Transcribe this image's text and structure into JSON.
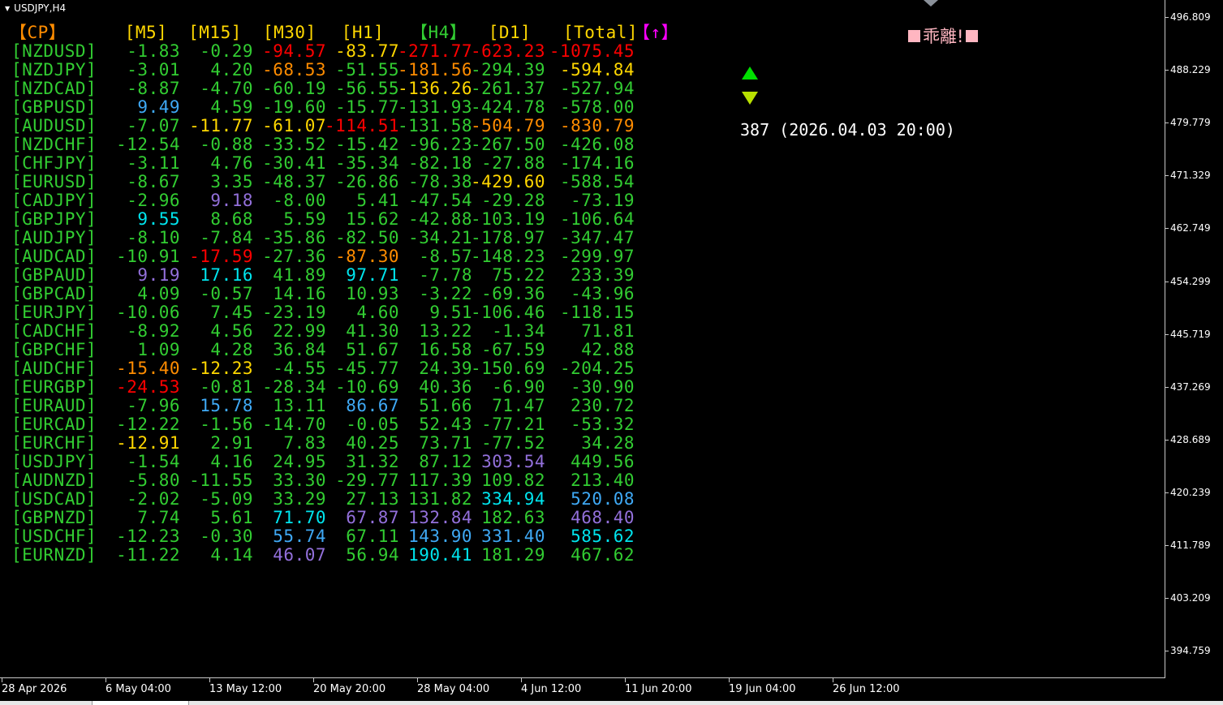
{
  "chart": {
    "title": "USDJPY,H4",
    "alert_text": "乖離!",
    "status_text": "387 (2026.04.03 20:00)"
  },
  "table": {
    "headers": [
      {
        "label": "【CP】",
        "color": "#ff8c00"
      },
      {
        "label": "[M5]",
        "color": "#ffd700"
      },
      {
        "label": "[M15]",
        "color": "#ffd700"
      },
      {
        "label": "[M30]",
        "color": "#ffd700"
      },
      {
        "label": "[H1]",
        "color": "#ffd700"
      },
      {
        "label": "【H4】",
        "color": "#32cd32"
      },
      {
        "label": "[D1]",
        "color": "#ffd700"
      },
      {
        "label": "[Total]",
        "color": "#ffd700"
      },
      {
        "label": "【↑】",
        "color": "#ff00ff"
      }
    ],
    "rows": [
      {
        "pair": "[NZDUSD]",
        "cells": [
          {
            "v": "-1.83",
            "c": "#32cd32"
          },
          {
            "v": "-0.29",
            "c": "#32cd32"
          },
          {
            "v": "-94.57",
            "c": "#ff0000"
          },
          {
            "v": "-83.77",
            "c": "#ffd700"
          },
          {
            "v": "-271.77",
            "c": "#ff0000"
          },
          {
            "v": "-623.23",
            "c": "#ff0000"
          },
          {
            "v": "-1075.45",
            "c": "#ff0000"
          }
        ]
      },
      {
        "pair": "[NZDJPY]",
        "cells": [
          {
            "v": "-3.01",
            "c": "#32cd32"
          },
          {
            "v": "4.20",
            "c": "#32cd32"
          },
          {
            "v": "-68.53",
            "c": "#ff8c00"
          },
          {
            "v": "-51.55",
            "c": "#32cd32"
          },
          {
            "v": "-181.56",
            "c": "#ff8c00"
          },
          {
            "v": "-294.39",
            "c": "#32cd32"
          },
          {
            "v": "-594.84",
            "c": "#ffd700"
          }
        ]
      },
      {
        "pair": "[NZDCAD]",
        "cells": [
          {
            "v": "-8.87",
            "c": "#32cd32"
          },
          {
            "v": "-4.70",
            "c": "#32cd32"
          },
          {
            "v": "-60.19",
            "c": "#32cd32"
          },
          {
            "v": "-56.55",
            "c": "#32cd32"
          },
          {
            "v": "-136.26",
            "c": "#ffd700"
          },
          {
            "v": "-261.37",
            "c": "#32cd32"
          },
          {
            "v": "-527.94",
            "c": "#32cd32"
          }
        ]
      },
      {
        "pair": "[GBPUSD]",
        "cells": [
          {
            "v": "9.49",
            "c": "#3fa9f5"
          },
          {
            "v": "4.59",
            "c": "#32cd32"
          },
          {
            "v": "-19.60",
            "c": "#32cd32"
          },
          {
            "v": "-15.77",
            "c": "#32cd32"
          },
          {
            "v": "-131.93",
            "c": "#32cd32"
          },
          {
            "v": "-424.78",
            "c": "#32cd32"
          },
          {
            "v": "-578.00",
            "c": "#32cd32"
          }
        ]
      },
      {
        "pair": "[AUDUSD]",
        "cells": [
          {
            "v": "-7.07",
            "c": "#32cd32"
          },
          {
            "v": "-11.77",
            "c": "#ffd700"
          },
          {
            "v": "-61.07",
            "c": "#ffd700"
          },
          {
            "v": "-114.51",
            "c": "#ff0000"
          },
          {
            "v": "-131.58",
            "c": "#32cd32"
          },
          {
            "v": "-504.79",
            "c": "#ff8c00"
          },
          {
            "v": "-830.79",
            "c": "#ff8c00"
          }
        ]
      },
      {
        "pair": "[NZDCHF]",
        "cells": [
          {
            "v": "-12.54",
            "c": "#32cd32"
          },
          {
            "v": "-0.88",
            "c": "#32cd32"
          },
          {
            "v": "-33.52",
            "c": "#32cd32"
          },
          {
            "v": "-15.42",
            "c": "#32cd32"
          },
          {
            "v": "-96.23",
            "c": "#32cd32"
          },
          {
            "v": "-267.50",
            "c": "#32cd32"
          },
          {
            "v": "-426.08",
            "c": "#32cd32"
          }
        ]
      },
      {
        "pair": "[CHFJPY]",
        "cells": [
          {
            "v": "-3.11",
            "c": "#32cd32"
          },
          {
            "v": "4.76",
            "c": "#32cd32"
          },
          {
            "v": "-30.41",
            "c": "#32cd32"
          },
          {
            "v": "-35.34",
            "c": "#32cd32"
          },
          {
            "v": "-82.18",
            "c": "#32cd32"
          },
          {
            "v": "-27.88",
            "c": "#32cd32"
          },
          {
            "v": "-174.16",
            "c": "#32cd32"
          }
        ]
      },
      {
        "pair": "[EURUSD]",
        "cells": [
          {
            "v": "-8.67",
            "c": "#32cd32"
          },
          {
            "v": "3.35",
            "c": "#32cd32"
          },
          {
            "v": "-48.37",
            "c": "#32cd32"
          },
          {
            "v": "-26.86",
            "c": "#32cd32"
          },
          {
            "v": "-78.38",
            "c": "#32cd32"
          },
          {
            "v": "-429.60",
            "c": "#ffd700"
          },
          {
            "v": "-588.54",
            "c": "#32cd32"
          }
        ]
      },
      {
        "pair": "[CADJPY]",
        "cells": [
          {
            "v": "-2.96",
            "c": "#32cd32"
          },
          {
            "v": "9.18",
            "c": "#9370db"
          },
          {
            "v": "-8.00",
            "c": "#32cd32"
          },
          {
            "v": "5.41",
            "c": "#32cd32"
          },
          {
            "v": "-47.54",
            "c": "#32cd32"
          },
          {
            "v": "-29.28",
            "c": "#32cd32"
          },
          {
            "v": "-73.19",
            "c": "#32cd32"
          }
        ]
      },
      {
        "pair": "[GBPJPY]",
        "cells": [
          {
            "v": "9.55",
            "c": "#00e5ee"
          },
          {
            "v": "8.68",
            "c": "#32cd32"
          },
          {
            "v": "5.59",
            "c": "#32cd32"
          },
          {
            "v": "15.62",
            "c": "#32cd32"
          },
          {
            "v": "-42.88",
            "c": "#32cd32"
          },
          {
            "v": "-103.19",
            "c": "#32cd32"
          },
          {
            "v": "-106.64",
            "c": "#32cd32"
          }
        ]
      },
      {
        "pair": "[AUDJPY]",
        "cells": [
          {
            "v": "-8.10",
            "c": "#32cd32"
          },
          {
            "v": "-7.84",
            "c": "#32cd32"
          },
          {
            "v": "-35.86",
            "c": "#32cd32"
          },
          {
            "v": "-82.50",
            "c": "#32cd32"
          },
          {
            "v": "-34.21",
            "c": "#32cd32"
          },
          {
            "v": "-178.97",
            "c": "#32cd32"
          },
          {
            "v": "-347.47",
            "c": "#32cd32"
          }
        ]
      },
      {
        "pair": "[AUDCAD]",
        "cells": [
          {
            "v": "-10.91",
            "c": "#32cd32"
          },
          {
            "v": "-17.59",
            "c": "#ff0000"
          },
          {
            "v": "-27.36",
            "c": "#32cd32"
          },
          {
            "v": "-87.30",
            "c": "#ff8c00"
          },
          {
            "v": "-8.57",
            "c": "#32cd32"
          },
          {
            "v": "-148.23",
            "c": "#32cd32"
          },
          {
            "v": "-299.97",
            "c": "#32cd32"
          }
        ]
      },
      {
        "pair": "[GBPAUD]",
        "cells": [
          {
            "v": "9.19",
            "c": "#9370db"
          },
          {
            "v": "17.16",
            "c": "#00e5ee"
          },
          {
            "v": "41.89",
            "c": "#32cd32"
          },
          {
            "v": "97.71",
            "c": "#00e5ee"
          },
          {
            "v": "-7.78",
            "c": "#32cd32"
          },
          {
            "v": "75.22",
            "c": "#32cd32"
          },
          {
            "v": "233.39",
            "c": "#32cd32"
          }
        ]
      },
      {
        "pair": "[GBPCAD]",
        "cells": [
          {
            "v": "4.09",
            "c": "#32cd32"
          },
          {
            "v": "-0.57",
            "c": "#32cd32"
          },
          {
            "v": "14.16",
            "c": "#32cd32"
          },
          {
            "v": "10.93",
            "c": "#32cd32"
          },
          {
            "v": "-3.22",
            "c": "#32cd32"
          },
          {
            "v": "-69.36",
            "c": "#32cd32"
          },
          {
            "v": "-43.96",
            "c": "#32cd32"
          }
        ]
      },
      {
        "pair": "[EURJPY]",
        "cells": [
          {
            "v": "-10.06",
            "c": "#32cd32"
          },
          {
            "v": "7.45",
            "c": "#32cd32"
          },
          {
            "v": "-23.19",
            "c": "#32cd32"
          },
          {
            "v": "4.60",
            "c": "#32cd32"
          },
          {
            "v": "9.51",
            "c": "#32cd32"
          },
          {
            "v": "-106.46",
            "c": "#32cd32"
          },
          {
            "v": "-118.15",
            "c": "#32cd32"
          }
        ]
      },
      {
        "pair": "[CADCHF]",
        "cells": [
          {
            "v": "-8.92",
            "c": "#32cd32"
          },
          {
            "v": "4.56",
            "c": "#32cd32"
          },
          {
            "v": "22.99",
            "c": "#32cd32"
          },
          {
            "v": "41.30",
            "c": "#32cd32"
          },
          {
            "v": "13.22",
            "c": "#32cd32"
          },
          {
            "v": "-1.34",
            "c": "#32cd32"
          },
          {
            "v": "71.81",
            "c": "#32cd32"
          }
        ]
      },
      {
        "pair": "[GBPCHF]",
        "cells": [
          {
            "v": "1.09",
            "c": "#32cd32"
          },
          {
            "v": "4.28",
            "c": "#32cd32"
          },
          {
            "v": "36.84",
            "c": "#32cd32"
          },
          {
            "v": "51.67",
            "c": "#32cd32"
          },
          {
            "v": "16.58",
            "c": "#32cd32"
          },
          {
            "v": "-67.59",
            "c": "#32cd32"
          },
          {
            "v": "42.88",
            "c": "#32cd32"
          }
        ]
      },
      {
        "pair": "[AUDCHF]",
        "cells": [
          {
            "v": "-15.40",
            "c": "#ff8c00"
          },
          {
            "v": "-12.23",
            "c": "#ffd700"
          },
          {
            "v": "-4.55",
            "c": "#32cd32"
          },
          {
            "v": "-45.77",
            "c": "#32cd32"
          },
          {
            "v": "24.39",
            "c": "#32cd32"
          },
          {
            "v": "-150.69",
            "c": "#32cd32"
          },
          {
            "v": "-204.25",
            "c": "#32cd32"
          }
        ]
      },
      {
        "pair": "[EURGBP]",
        "cells": [
          {
            "v": "-24.53",
            "c": "#ff0000"
          },
          {
            "v": "-0.81",
            "c": "#32cd32"
          },
          {
            "v": "-28.34",
            "c": "#32cd32"
          },
          {
            "v": "-10.69",
            "c": "#32cd32"
          },
          {
            "v": "40.36",
            "c": "#32cd32"
          },
          {
            "v": "-6.90",
            "c": "#32cd32"
          },
          {
            "v": "-30.90",
            "c": "#32cd32"
          }
        ]
      },
      {
        "pair": "[EURAUD]",
        "cells": [
          {
            "v": "-7.96",
            "c": "#32cd32"
          },
          {
            "v": "15.78",
            "c": "#3fa9f5"
          },
          {
            "v": "13.11",
            "c": "#32cd32"
          },
          {
            "v": "86.67",
            "c": "#3fa9f5"
          },
          {
            "v": "51.66",
            "c": "#32cd32"
          },
          {
            "v": "71.47",
            "c": "#32cd32"
          },
          {
            "v": "230.72",
            "c": "#32cd32"
          }
        ]
      },
      {
        "pair": "[EURCAD]",
        "cells": [
          {
            "v": "-12.22",
            "c": "#32cd32"
          },
          {
            "v": "-1.56",
            "c": "#32cd32"
          },
          {
            "v": "-14.70",
            "c": "#32cd32"
          },
          {
            "v": "-0.05",
            "c": "#32cd32"
          },
          {
            "v": "52.43",
            "c": "#32cd32"
          },
          {
            "v": "-77.21",
            "c": "#32cd32"
          },
          {
            "v": "-53.32",
            "c": "#32cd32"
          }
        ]
      },
      {
        "pair": "[EURCHF]",
        "cells": [
          {
            "v": "-12.91",
            "c": "#ffd700"
          },
          {
            "v": "2.91",
            "c": "#32cd32"
          },
          {
            "v": "7.83",
            "c": "#32cd32"
          },
          {
            "v": "40.25",
            "c": "#32cd32"
          },
          {
            "v": "73.71",
            "c": "#32cd32"
          },
          {
            "v": "-77.52",
            "c": "#32cd32"
          },
          {
            "v": "34.28",
            "c": "#32cd32"
          }
        ]
      },
      {
        "pair": "[USDJPY]",
        "cells": [
          {
            "v": "-1.54",
            "c": "#32cd32"
          },
          {
            "v": "4.16",
            "c": "#32cd32"
          },
          {
            "v": "24.95",
            "c": "#32cd32"
          },
          {
            "v": "31.32",
            "c": "#32cd32"
          },
          {
            "v": "87.12",
            "c": "#32cd32"
          },
          {
            "v": "303.54",
            "c": "#9370db"
          },
          {
            "v": "449.56",
            "c": "#32cd32"
          }
        ]
      },
      {
        "pair": "[AUDNZD]",
        "cells": [
          {
            "v": "-5.80",
            "c": "#32cd32"
          },
          {
            "v": "-11.55",
            "c": "#32cd32"
          },
          {
            "v": "33.30",
            "c": "#32cd32"
          },
          {
            "v": "-29.77",
            "c": "#32cd32"
          },
          {
            "v": "117.39",
            "c": "#32cd32"
          },
          {
            "v": "109.82",
            "c": "#32cd32"
          },
          {
            "v": "213.40",
            "c": "#32cd32"
          }
        ]
      },
      {
        "pair": "[USDCAD]",
        "cells": [
          {
            "v": "-2.02",
            "c": "#32cd32"
          },
          {
            "v": "-5.09",
            "c": "#32cd32"
          },
          {
            "v": "33.29",
            "c": "#32cd32"
          },
          {
            "v": "27.13",
            "c": "#32cd32"
          },
          {
            "v": "131.82",
            "c": "#32cd32"
          },
          {
            "v": "334.94",
            "c": "#00e5ee"
          },
          {
            "v": "520.08",
            "c": "#3fa9f5"
          }
        ]
      },
      {
        "pair": "[GBPNZD]",
        "cells": [
          {
            "v": "7.74",
            "c": "#32cd32"
          },
          {
            "v": "5.61",
            "c": "#32cd32"
          },
          {
            "v": "71.70",
            "c": "#00e5ee"
          },
          {
            "v": "67.87",
            "c": "#9370db"
          },
          {
            "v": "132.84",
            "c": "#9370db"
          },
          {
            "v": "182.63",
            "c": "#32cd32"
          },
          {
            "v": "468.40",
            "c": "#9370db"
          }
        ]
      },
      {
        "pair": "[USDCHF]",
        "cells": [
          {
            "v": "-12.23",
            "c": "#32cd32"
          },
          {
            "v": "-0.30",
            "c": "#32cd32"
          },
          {
            "v": "55.74",
            "c": "#3fa9f5"
          },
          {
            "v": "67.11",
            "c": "#32cd32"
          },
          {
            "v": "143.90",
            "c": "#3fa9f5"
          },
          {
            "v": "331.40",
            "c": "#3fa9f5"
          },
          {
            "v": "585.62",
            "c": "#00e5ee"
          }
        ]
      },
      {
        "pair": "[EURNZD]",
        "cells": [
          {
            "v": "-11.22",
            "c": "#32cd32"
          },
          {
            "v": "4.14",
            "c": "#32cd32"
          },
          {
            "v": "46.07",
            "c": "#9370db"
          },
          {
            "v": "56.94",
            "c": "#32cd32"
          },
          {
            "v": "190.41",
            "c": "#00e5ee"
          },
          {
            "v": "181.29",
            "c": "#32cd32"
          },
          {
            "v": "467.62",
            "c": "#32cd32"
          }
        ]
      }
    ]
  },
  "price_axis": [
    "496.809",
    "488.229",
    "479.779",
    "471.329",
    "462.749",
    "454.299",
    "445.719",
    "437.269",
    "428.689",
    "420.239",
    "411.789",
    "403.209",
    "394.759"
  ],
  "time_axis": [
    "28 Apr 2026",
    "6 May 04:00",
    "13 May 12:00",
    "20 May 20:00",
    "28 May 04:00",
    "4 Jun 12:00",
    "11 Jun 20:00",
    "19 Jun 04:00",
    "26 Jun 12:00"
  ],
  "colors": {
    "background": "#000000",
    "axis_text": "#ffffff",
    "pair_label": "#32cd32",
    "arrow_up": "#00e000",
    "arrow_down": "#b8e000",
    "alert": "#ffb6c1"
  },
  "icons": [
    "dropdown-triangle-icon",
    "arrow-up-icon",
    "arrow-down-icon",
    "scroll-marker-icon"
  ]
}
